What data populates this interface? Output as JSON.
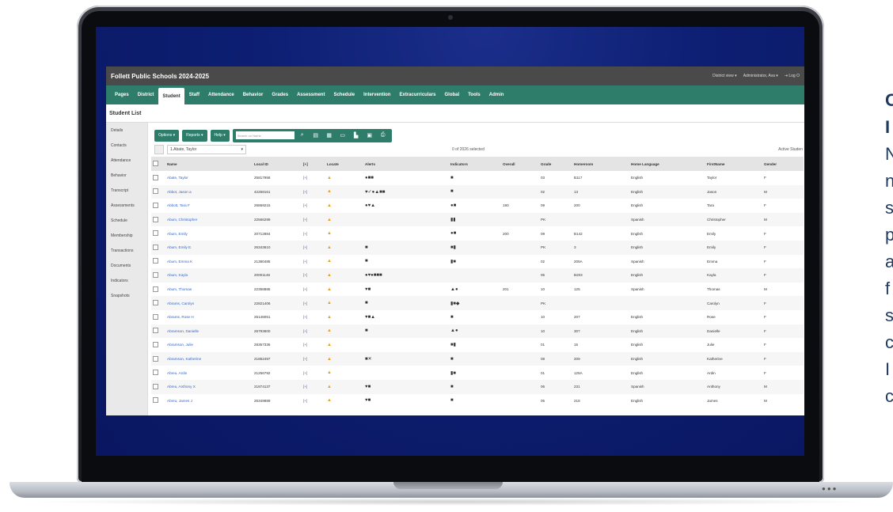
{
  "app": {
    "title": "Follett Public Schools 2024-2025",
    "topright": [
      "District view ▾",
      "Administrator, Ava ▾",
      "⇥ Log O"
    ]
  },
  "nav": [
    "Pages",
    "District",
    "Student",
    "Staff",
    "Attendance",
    "Behavior",
    "Grades",
    "Assessment",
    "Schedule",
    "Intervention",
    "Extracurriculars",
    "Global",
    "Tools",
    "Admin"
  ],
  "active_tab": "Student",
  "page_title": "Student List",
  "sidebar": [
    "Details",
    "Contacts",
    "Attendance",
    "Behavior",
    "Transcript",
    "Assessments",
    "Schedule",
    "Membership",
    "Transactions",
    "Documents",
    "Indicators",
    "Snapshots"
  ],
  "toolbar": {
    "options": "Options ▾",
    "reports": "Reports ▾",
    "help": "Help ▾",
    "search_placeholder": "Search on Name"
  },
  "filter": {
    "dropdown": "1.Abate, Taylor",
    "selected": "0 of 2026 selected",
    "active": "Active Studen"
  },
  "columns": [
    "",
    "Name",
    "Local ID",
    "[+]",
    "Locate",
    "Alerts",
    "Indicators",
    "Overall",
    "Grade",
    "Homeroom",
    "Home Language",
    "FirstName",
    "Gender"
  ],
  "rows": [
    [
      "Abate, Taylor",
      "25817958",
      "[+]",
      "▲",
      "●■■",
      "■",
      "",
      "03",
      "B117",
      "English",
      "Taylor",
      "F"
    ],
    [
      "Abbot, Jason a",
      "42258161",
      "[+]",
      "▲",
      "♥✓●▲■■",
      "■",
      "",
      "02",
      "13",
      "English",
      "Jason",
      "M"
    ],
    [
      "Abbott, Tara F",
      "26869215",
      "[+]",
      "▲",
      "●♥▲",
      "●■",
      "190",
      "09",
      "200",
      "English",
      "Tara",
      "F"
    ],
    [
      "Abum, Christopher",
      "22566299",
      "[+]",
      "▲",
      "",
      "▮▮",
      "",
      "PK",
      "",
      "Spanish",
      "Christopher",
      "M"
    ],
    [
      "Abum, Emily",
      "20712884",
      "[+]",
      "▲",
      "",
      "●■",
      "200",
      "09",
      "B142",
      "English",
      "Emily",
      "F"
    ],
    [
      "Abum, Emily E.",
      "26343610",
      "[+]",
      "▲",
      "■",
      "■▮",
      "",
      "PK",
      "3",
      "English",
      "Emily",
      "F"
    ],
    [
      "Abum, Emma K",
      "21380485",
      "[+]",
      "▲",
      "■",
      "▮■",
      "",
      "02",
      "205A",
      "Spanish",
      "Emma",
      "F"
    ],
    [
      "Abum, Kayla",
      "20001146",
      "[+]",
      "▲",
      "●♥●■■■",
      "",
      "",
      "05",
      "B203",
      "English",
      "Kayla",
      "F"
    ],
    [
      "Abum, Thomas",
      "22358885",
      "[+]",
      "▲",
      "♥■",
      "▲●",
      "201",
      "10",
      "125",
      "Spanish",
      "Thomas",
      "M"
    ],
    [
      "Abrams, Carolyn",
      "22821406",
      "[+]",
      "▲",
      "■",
      "▮■◆",
      "",
      "PK",
      "",
      "",
      "Carolyn",
      "F"
    ],
    [
      "Abrams, Rose H",
      "25148051",
      "[+]",
      "▲",
      "♥■▲",
      "■",
      "",
      "10",
      "207",
      "English",
      "Rose",
      "F"
    ],
    [
      "Abramson, Danielle",
      "26793600",
      "[+]",
      "▲",
      "■",
      "▲●",
      "",
      "10",
      "307",
      "English",
      "Danielle",
      "F"
    ],
    [
      "Abramson, Julie",
      "28357336",
      "[+]",
      "▲",
      "",
      "■▮",
      "",
      "01",
      "15",
      "English",
      "Julie",
      "F"
    ],
    [
      "Abramson, Katherine",
      "21852497",
      "[+]",
      "▲",
      "■✕",
      "■",
      "",
      "08",
      "209",
      "English",
      "Katherine",
      "F"
    ],
    [
      "Abreu, Ardin",
      "21256792",
      "[+]",
      "▲",
      "",
      "▮■",
      "",
      "01",
      "125A",
      "English",
      "Ardin",
      "F"
    ],
    [
      "Abreu, Anthony X",
      "21874137",
      "[+]",
      "▲",
      "♥■",
      "■",
      "",
      "06",
      "231",
      "Spanish",
      "Anthony",
      "M"
    ],
    [
      "Abreu, James J",
      "26349889",
      "[+]",
      "▲",
      "♥■",
      "■",
      "",
      "05",
      "218",
      "English",
      "James",
      "M"
    ]
  ],
  "promo_letters": [
    "C",
    "I",
    "N",
    "n",
    "s",
    "p",
    "a",
    "f",
    "s",
    "c",
    "I",
    "c"
  ],
  "colors": {
    "nav": "#2e7d6a",
    "titlebar": "#4a4a4a",
    "link": "#3366cc",
    "locate": "#e8a317"
  }
}
